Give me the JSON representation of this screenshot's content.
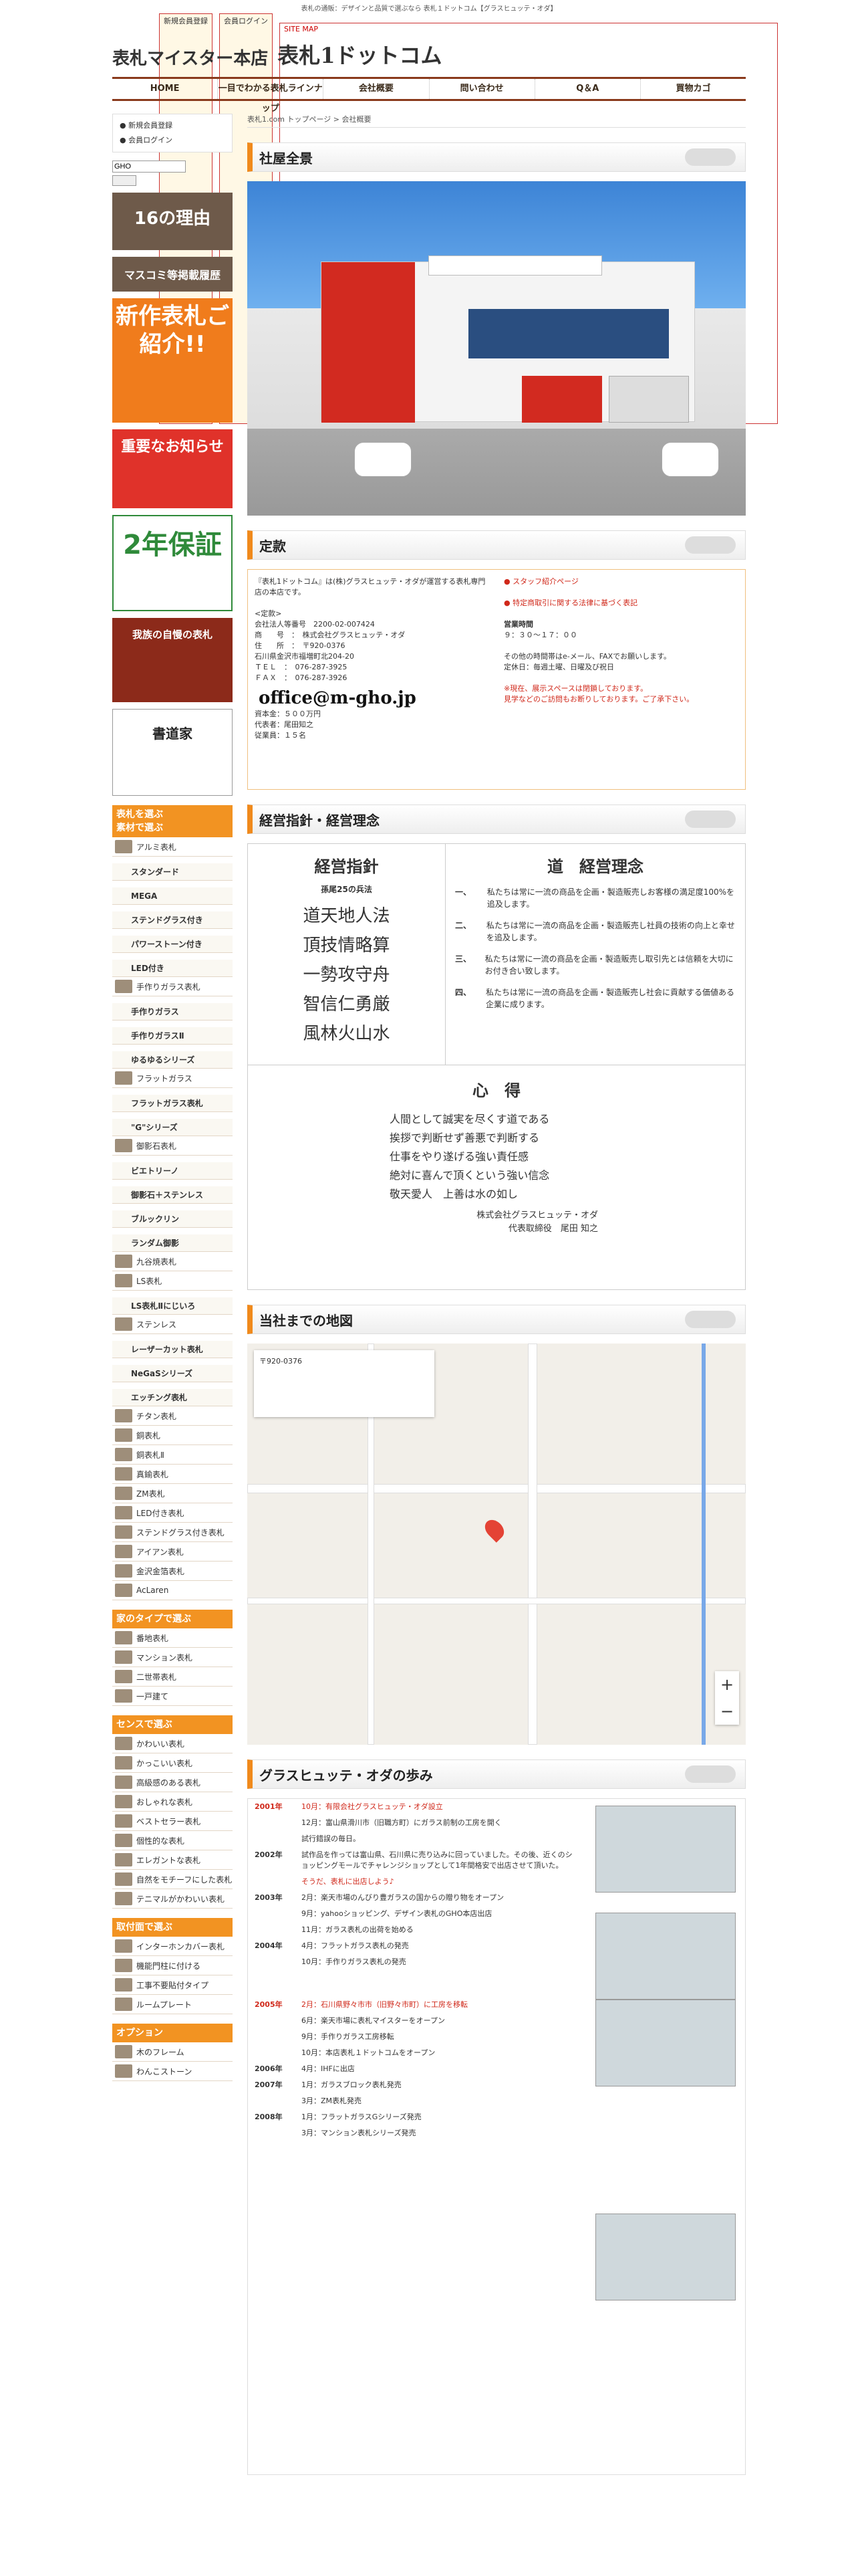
{
  "header": {
    "tagline": "表札の通販：デザインと品質で選ぶなら 表札１ドットコム【グラスヒュッテ・オダ】",
    "links": [
      "新規会員登録",
      "会員ログイン",
      "SITE MAP"
    ],
    "logo_left": "表札マイスター本店",
    "logo_right": "表札1ドットコム"
  },
  "nav": [
    "HOME",
    "一目でわかる表札ラインナップ",
    "会社概要",
    "問い合わせ",
    "Q＆A",
    "買物カゴ"
  ],
  "sidebar": {
    "account": [
      "新規会員登録",
      "会員ログイン"
    ],
    "search_value": "GHO",
    "banners": [
      "16の理由",
      "マスコミ等掲載履歴",
      "新作表札ご紹介!!",
      "重要なお知らせ",
      "2年保証",
      "我族の自慢の表札",
      "書道家"
    ],
    "menu1_title": "表札を選ぶ",
    "menu1_sub": "素材で選ぶ",
    "materials": [
      "アルミ表札",
      "スタンダード",
      "MEGA",
      "ステンドグラス付き",
      "パワーストーン付き",
      "LED付き",
      "手作りガラス表札",
      "手作りガラス",
      "手作りガラスⅡ",
      "ゆるゆるシリーズ",
      "フラットガラス",
      "フラットガラス表札",
      "\"G\"シリーズ",
      "御影石表札",
      "ビエトリーノ",
      "御影石＋ステンレス",
      "ブルックリン",
      "ランダム御影",
      "九谷焼表札",
      "LS表札",
      "LS表札Ⅱにじいろ",
      "ステンレス",
      "レーザーカット表札",
      "NeGaSシリーズ",
      "エッチング表札",
      "チタン表札",
      "銅表札",
      "銅表札Ⅱ",
      "真鍮表札",
      "ZM表札",
      "LED付き表札",
      "ステンドグラス付き表札",
      "アイアン表札",
      "金沢金箔表札",
      "AcLaren"
    ],
    "menu2_title": "家のタイプで選ぶ",
    "types": [
      "番地表札",
      "マンション表札",
      "二世帯表札",
      "一戸建て"
    ],
    "menu3_title": "センスで選ぶ",
    "sense": [
      "かわいい表札",
      "かっこいい表札",
      "高級感のある表札",
      "おしゃれな表札",
      "ベストセラー表札",
      "個性的な表札",
      "エレガントな表札",
      "自然をモチーフにした表札",
      "テニマルがかわいい表札"
    ],
    "menu4_title": "取付面で選ぶ",
    "mount": [
      "インターホンカバー表札",
      "機能門柱に付ける",
      "工事不要貼付タイプ",
      "ルームプレート"
    ],
    "menu5_title": "オプション",
    "options": [
      "木のフレーム",
      "わんこストーン"
    ]
  },
  "main": {
    "breadcrumb": "表札1.com トップページ > 会社概要",
    "sec1": "社屋全景",
    "sec2": "定款",
    "sec3": "経営指針・経営理念",
    "sec4": "当社までの地図",
    "sec5": "グラスヒュッテ・オダの歩み",
    "teikan_left": [
      "『表札1ドットコム』は(株)グラスヒュッテ・オダが運営する表札専門店の本店です。",
      "<定款>",
      "会社法人等番号　2200-02-007424",
      "商　　号　：　株式会社グラスヒュッテ・オダ",
      "住　　所　：　〒920-0376",
      "石川県金沢市福増町北204-20",
      "ＴＥＬ　：　076-287-3925",
      "ＦＡＸ　：　076-287-3926"
    ],
    "email": "office@m-gho.jp",
    "capital": [
      "資本金：５００万円",
      "代表者：尾田知之",
      "従業員：１５名"
    ],
    "teikan_right": [
      "スタッフ紹介ページ",
      "特定商取引に関する法律に基づく表記",
      "営業時間",
      "９：３０～１７：００",
      "その他の時間帯はe-メール、FAXでお願いします。",
      "定休日：毎週土曜、日曜及び祝日",
      "※現在、展示スペースは閉鎖しております。",
      "見学などのご訪問もお断りしております。ご了承下さい。"
    ],
    "policy_title": "経営指針",
    "policy_sub": "孫尾25の兵法",
    "policy_words": [
      "道天地人法",
      "頂技情略算",
      "一勢攻守舟",
      "智信仁勇厳",
      "風林火山水"
    ],
    "rinen_title": "道　経営理念",
    "rinen": [
      {
        "n": "一、",
        "t": "私たちは常に一流の商品を企画・製造販売しお客様の満足度100%を追及します。"
      },
      {
        "n": "二、",
        "t": "私たちは常に一流の商品を企画・製造販売し社員の技術の向上と幸せを追及します。"
      },
      {
        "n": "三、",
        "t": "私たちは常に一流の商品を企画・製造販売し取引先とは信頼を大切にお付き合い致します。"
      },
      {
        "n": "四、",
        "t": "私たちは常に一流の商品を企画・製造販売し社会に貢献する価値ある企業に成ります。"
      }
    ],
    "kokoro_title": "心　得",
    "kokoro": [
      "人間として誠実を尽くす道である",
      "挨拶で判断せず善悪で判断する",
      "仕事をやり遂げる強い責任感",
      "絶対に喜んで頂くという強い信念",
      "敬天愛人　上善は水の如し"
    ],
    "sign": [
      "株式会社グラスヒュッテ・オダ",
      "代表取締役　尾田 知之"
    ],
    "map_pop": "〒920-0376",
    "history": [
      {
        "y": "2001年",
        "t": "10月：有限会社グラスヒュッテ・オダ設立",
        "r": true
      },
      {
        "y": "",
        "t": "12月：富山県滑川市（旧職方町）にガラス前制の工房を開く"
      },
      {
        "y": "",
        "t": "試行錯誤の毎日。"
      },
      {
        "y": "2002年",
        "t": "試作品を作っては富山県、石川県に売り込みに回っていました。その後、近くのショッピングモールでチャレンジショップとして1年間格安で出店させて頂いた。"
      },
      {
        "y": "",
        "t": "そうだ、表札に出店しよう♪"
      },
      {
        "y": "2003年",
        "t": "2月：楽天市場のんびり豊ガラスの国からの贈り物をオープン"
      },
      {
        "y": "",
        "t": "9月：yahooショッピング、デザイン表札のGHO本店出店"
      },
      {
        "y": "",
        "t": "11月：ガラス表札の出荷を始める"
      },
      {
        "y": "2004年",
        "t": "4月：フラットガラス表札の発売"
      },
      {
        "y": "",
        "t": "10月：手作りガラス表札の発売"
      },
      {
        "y": "2005年",
        "t": "2月：石川県野々市市（旧野々市町）に工房を移転",
        "r": true
      },
      {
        "y": "",
        "t": "6月：楽天市場に表札マイスターをオープン"
      },
      {
        "y": "",
        "t": "9月：手作りガラス工房移転"
      },
      {
        "y": "",
        "t": "10月：本店表札１ドットコムをオープン"
      },
      {
        "y": "2006年",
        "t": "4月：IHFに出店"
      },
      {
        "y": "2007年",
        "t": "1月：ガラスブロック表札発売"
      },
      {
        "y": "",
        "t": "3月：ZM表札発売"
      },
      {
        "y": "2008年",
        "t": "1月：フラットガラスGシリーズ発売"
      },
      {
        "y": "",
        "t": "3月：マンション表札シリーズ発売"
      }
    ]
  }
}
